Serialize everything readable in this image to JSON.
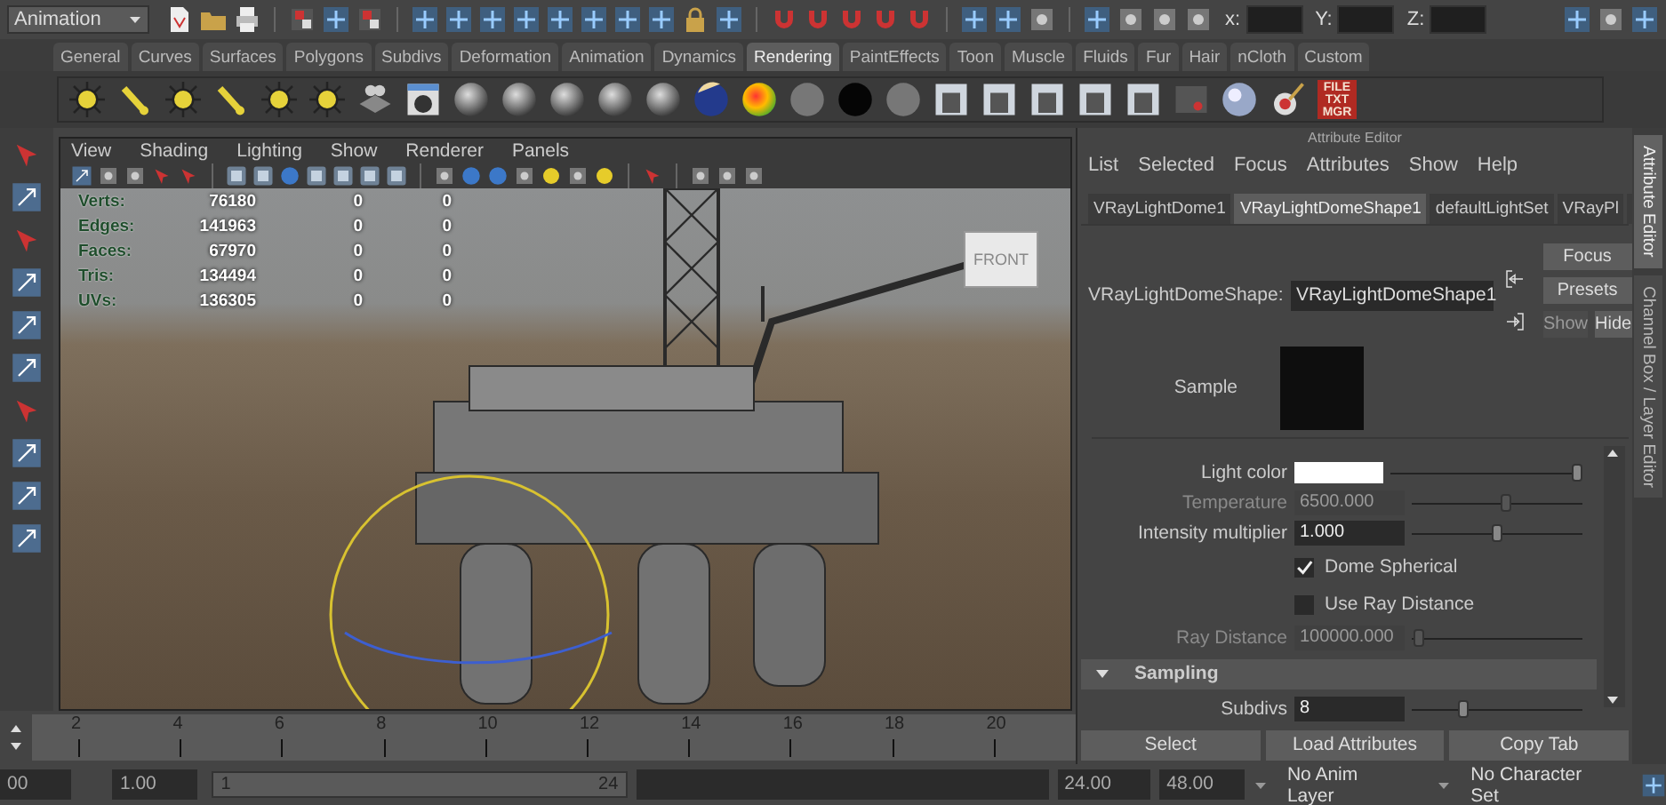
{
  "status_line": {
    "mode_menu": "Animation",
    "coordinate_fields": [
      {
        "label": "x:"
      },
      {
        "label": "Y:"
      },
      {
        "label": "Z:"
      }
    ]
  },
  "shelf": {
    "tabs": [
      {
        "label": "General",
        "selected": false
      },
      {
        "label": "Curves",
        "selected": false
      },
      {
        "label": "Surfaces",
        "selected": false
      },
      {
        "label": "Polygons",
        "selected": false
      },
      {
        "label": "Subdivs",
        "selected": false
      },
      {
        "label": "Deformation",
        "selected": false
      },
      {
        "label": "Animation",
        "selected": false
      },
      {
        "label": "Dynamics",
        "selected": false
      },
      {
        "label": "Rendering",
        "selected": true
      },
      {
        "label": "PaintEffects",
        "selected": false
      },
      {
        "label": "Toon",
        "selected": false
      },
      {
        "label": "Muscle",
        "selected": false
      },
      {
        "label": "Fluids",
        "selected": false
      },
      {
        "label": "Fur",
        "selected": false
      },
      {
        "label": "Hair",
        "selected": false
      },
      {
        "label": "nCloth",
        "selected": false
      },
      {
        "label": "Custom",
        "selected": false
      }
    ],
    "text_button": "FILE TXT MGR"
  },
  "viewport": {
    "menus": [
      "View",
      "Shading",
      "Lighting",
      "Show",
      "Renderer",
      "Panels"
    ],
    "hud": [
      {
        "label": "Verts:",
        "values": [
          "76180",
          "0",
          "0"
        ]
      },
      {
        "label": "Edges:",
        "values": [
          "141963",
          "0",
          "0"
        ]
      },
      {
        "label": "Faces:",
        "values": [
          "67970",
          "0",
          "0"
        ]
      },
      {
        "label": "Tris:",
        "values": [
          "134494",
          "0",
          "0"
        ]
      },
      {
        "label": "UVs:",
        "values": [
          "136305",
          "0",
          "0"
        ]
      }
    ],
    "view_cube": "FRONT"
  },
  "attribute_editor": {
    "title": "Attribute Editor",
    "menus": [
      "List",
      "Selected",
      "Focus",
      "Attributes",
      "Show",
      "Help"
    ],
    "tabs": [
      {
        "label": "VRayLightDome1",
        "selected": false
      },
      {
        "label": "VRayLightDomeShape1",
        "selected": true
      },
      {
        "label": "defaultLightSet",
        "selected": false
      },
      {
        "label": "VRayPl",
        "selected": false
      }
    ],
    "node_label": "VRayLightDomeShape:",
    "node_value": "VRayLightDomeShape1",
    "buttons": [
      {
        "label": "Focus",
        "disabled": false
      },
      {
        "label": "Presets",
        "disabled": false
      },
      {
        "label": "Show",
        "disabled": true
      },
      {
        "label": "Hide",
        "disabled": false
      }
    ],
    "sample_label": "Sample",
    "rows": [
      {
        "kind": "color",
        "label": "Light color",
        "level": 0.97,
        "disabled": false
      },
      {
        "kind": "slider",
        "label": "Temperature",
        "value": "6500.000",
        "level": 0.55,
        "disabled": true
      },
      {
        "kind": "slider",
        "label": "Intensity multiplier",
        "value": "1.000",
        "level": 0.5,
        "disabled": false
      },
      {
        "kind": "checkbox",
        "label": "Dome Spherical",
        "checked": true
      },
      {
        "kind": "checkbox",
        "label": "Use Ray Distance",
        "checked": false
      },
      {
        "kind": "slider",
        "label": "Ray Distance",
        "value": "100000.000",
        "level": 0.04,
        "disabled": true
      },
      {
        "kind": "section",
        "label": "Sampling",
        "expanded": true
      },
      {
        "kind": "slider",
        "label": "Subdivs",
        "value": "8",
        "level": 0.3,
        "disabled": false
      }
    ],
    "bottom_buttons": [
      "Select",
      "Load Attributes",
      "Copy Tab"
    ]
  },
  "side_tabs": [
    {
      "label": "Attribute Editor",
      "selected": true
    },
    {
      "label": "Channel Box / Layer Editor",
      "selected": false
    }
  ],
  "time_slider": {
    "ticks": [
      "2",
      "4",
      "6",
      "8",
      "10",
      "12",
      "14",
      "16",
      "18",
      "20"
    ]
  },
  "range_slider": {
    "start_field": "00",
    "playback_start": "1.00",
    "range_start": "1",
    "range_end": "24",
    "playback_end": "24.00",
    "end_field": "48.00",
    "anim_layer": "No Anim Layer",
    "character_set": "No Character Set"
  }
}
